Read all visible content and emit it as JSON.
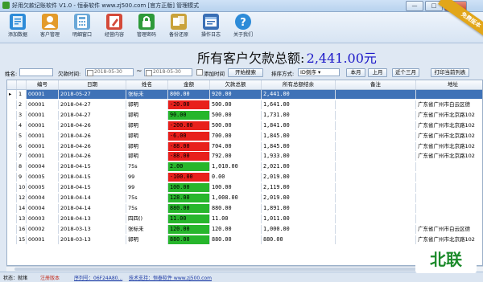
{
  "window": {
    "title": "好用欠款记账软件 V1.0 - 恒泰软件  www.zj500.com [官方正版]  管理模式",
    "min_label": "—",
    "max_label": "□",
    "close_label": "✕",
    "badge": "免费版本"
  },
  "toolbar": {
    "items": [
      {
        "label": "添加数据",
        "icon": "add-data-icon",
        "color": "#2d8bd8"
      },
      {
        "label": "客户管理",
        "icon": "customer-icon",
        "color": "#e39b2b"
      },
      {
        "label": "明细窗口",
        "icon": "calculator-icon",
        "color": "#6aa8d8"
      },
      {
        "label": "经营内容",
        "icon": "edit-icon",
        "color": "#d44a3a"
      },
      {
        "label": "管理密码",
        "icon": "lock-icon",
        "color": "#2e9a3a"
      },
      {
        "label": "备份还原",
        "icon": "backup-icon",
        "color": "#c9a23b"
      },
      {
        "label": "操作日志",
        "icon": "log-icon",
        "color": "#3a6fb5"
      },
      {
        "label": "关于我们",
        "icon": "help-icon",
        "color": "#2d8bd8"
      }
    ]
  },
  "banner": {
    "label": "所有客户欠款总额:",
    "amount": "2,441.00元"
  },
  "filters": {
    "name_label": "姓名:",
    "debt_time_label": "欠款时间:",
    "date_from": "2018-05-30",
    "tilde": "~",
    "date_to": "2018-05-30",
    "add_time_label": "添加时间",
    "search_button": "开始搜索",
    "sort_label": "排序方式:",
    "sort_value": "ID倒序 ▾",
    "this_month": "本月",
    "last_month": "上月",
    "last_three_months": "近个三月",
    "print_button": "打印当前列表"
  },
  "table": {
    "columns": [
      "编号",
      "日期",
      "姓名",
      "金额",
      "欠款总额",
      "所有总额结余",
      "备注",
      "地址"
    ],
    "rows": [
      {
        "id": "1",
        "code": "00001",
        "date": "2018-05-27",
        "name": "张标未",
        "amount": "800.00",
        "debt": "920.00",
        "total": "2,441.00",
        "note": "",
        "address": "",
        "color": "selected"
      },
      {
        "id": "2",
        "code": "00001",
        "date": "2018-04-27",
        "name": "郭明",
        "amount": "-20.00",
        "debt": "500.00",
        "total": "1,641.00",
        "note": "",
        "address": "广东省广州市白云区德",
        "color": "red"
      },
      {
        "id": "3",
        "code": "00001",
        "date": "2018-04-27",
        "name": "郭明",
        "amount": "90.00",
        "debt": "500.00",
        "total": "1,731.00",
        "note": "",
        "address": "广东省广州市北京路102",
        "color": "green"
      },
      {
        "id": "4",
        "code": "00001",
        "date": "2018-04-26",
        "name": "郭明",
        "amount": "-200.00",
        "debt": "500.00",
        "total": "1,841.00",
        "note": "",
        "address": "广东省广州市北京路102",
        "color": "red"
      },
      {
        "id": "5",
        "code": "00001",
        "date": "2018-04-26",
        "name": "郭明",
        "amount": "-6.00",
        "debt": "700.00",
        "total": "1,845.00",
        "note": "",
        "address": "广东省广州市北京路102",
        "color": "red"
      },
      {
        "id": "6",
        "code": "00001",
        "date": "2018-04-26",
        "name": "郭明",
        "amount": "-88.00",
        "debt": "704.00",
        "total": "1,845.00",
        "note": "",
        "address": "广东省广州市北京路102",
        "color": "red"
      },
      {
        "id": "7",
        "code": "00001",
        "date": "2018-04-26",
        "name": "郭明",
        "amount": "-88.00",
        "debt": "792.00",
        "total": "1,933.00",
        "note": "",
        "address": "广东省广州市北京路102",
        "color": "red"
      },
      {
        "id": "8",
        "code": "00004",
        "date": "2018-04-15",
        "name": "75s",
        "amount": "2.00",
        "debt": "1,010.00",
        "total": "2,021.00",
        "note": "",
        "address": "",
        "color": "green"
      },
      {
        "id": "9",
        "code": "00005",
        "date": "2018-04-15",
        "name": "99",
        "amount": "-100.00",
        "debt": "0.00",
        "total": "2,019.00",
        "note": "",
        "address": "",
        "color": "red"
      },
      {
        "id": "10",
        "code": "00005",
        "date": "2018-04-15",
        "name": "99",
        "amount": "100.00",
        "debt": "100.00",
        "total": "2,119.00",
        "note": "",
        "address": "",
        "color": "green"
      },
      {
        "id": "12",
        "code": "00004",
        "date": "2018-04-14",
        "name": "75s",
        "amount": "128.00",
        "debt": "1,008.00",
        "total": "2,019.00",
        "note": "",
        "address": "",
        "color": "green"
      },
      {
        "id": "14",
        "code": "00004",
        "date": "2018-04-14",
        "name": "75s",
        "amount": "880.00",
        "debt": "880.00",
        "total": "1,891.00",
        "note": "",
        "address": "",
        "color": "green"
      },
      {
        "id": "13",
        "code": "00003",
        "date": "2018-04-13",
        "name": "四四()",
        "amount": "11.00",
        "debt": "11.00",
        "total": "1,011.00",
        "note": "",
        "address": "",
        "color": "green"
      },
      {
        "id": "16",
        "code": "00002",
        "date": "2018-03-13",
        "name": "张标未",
        "amount": "120.00",
        "debt": "120.00",
        "total": "1,000.00",
        "note": "",
        "address": "广东省广州市白云区德",
        "color": "green"
      },
      {
        "id": "15",
        "code": "00001",
        "date": "2018-03-13",
        "name": "郭明",
        "amount": "880.00",
        "debt": "880.00",
        "total": "880.00",
        "note": "",
        "address": "广东省广州市北京路102",
        "color": "green"
      }
    ]
  },
  "statusbar": {
    "status_label": "状态：就绪",
    "license_label": "注册版本",
    "serial_label": "序列号：06F24A80...",
    "support_label": "技术支持：恒泰软件  www.zj500.com"
  },
  "watermark": "北联"
}
